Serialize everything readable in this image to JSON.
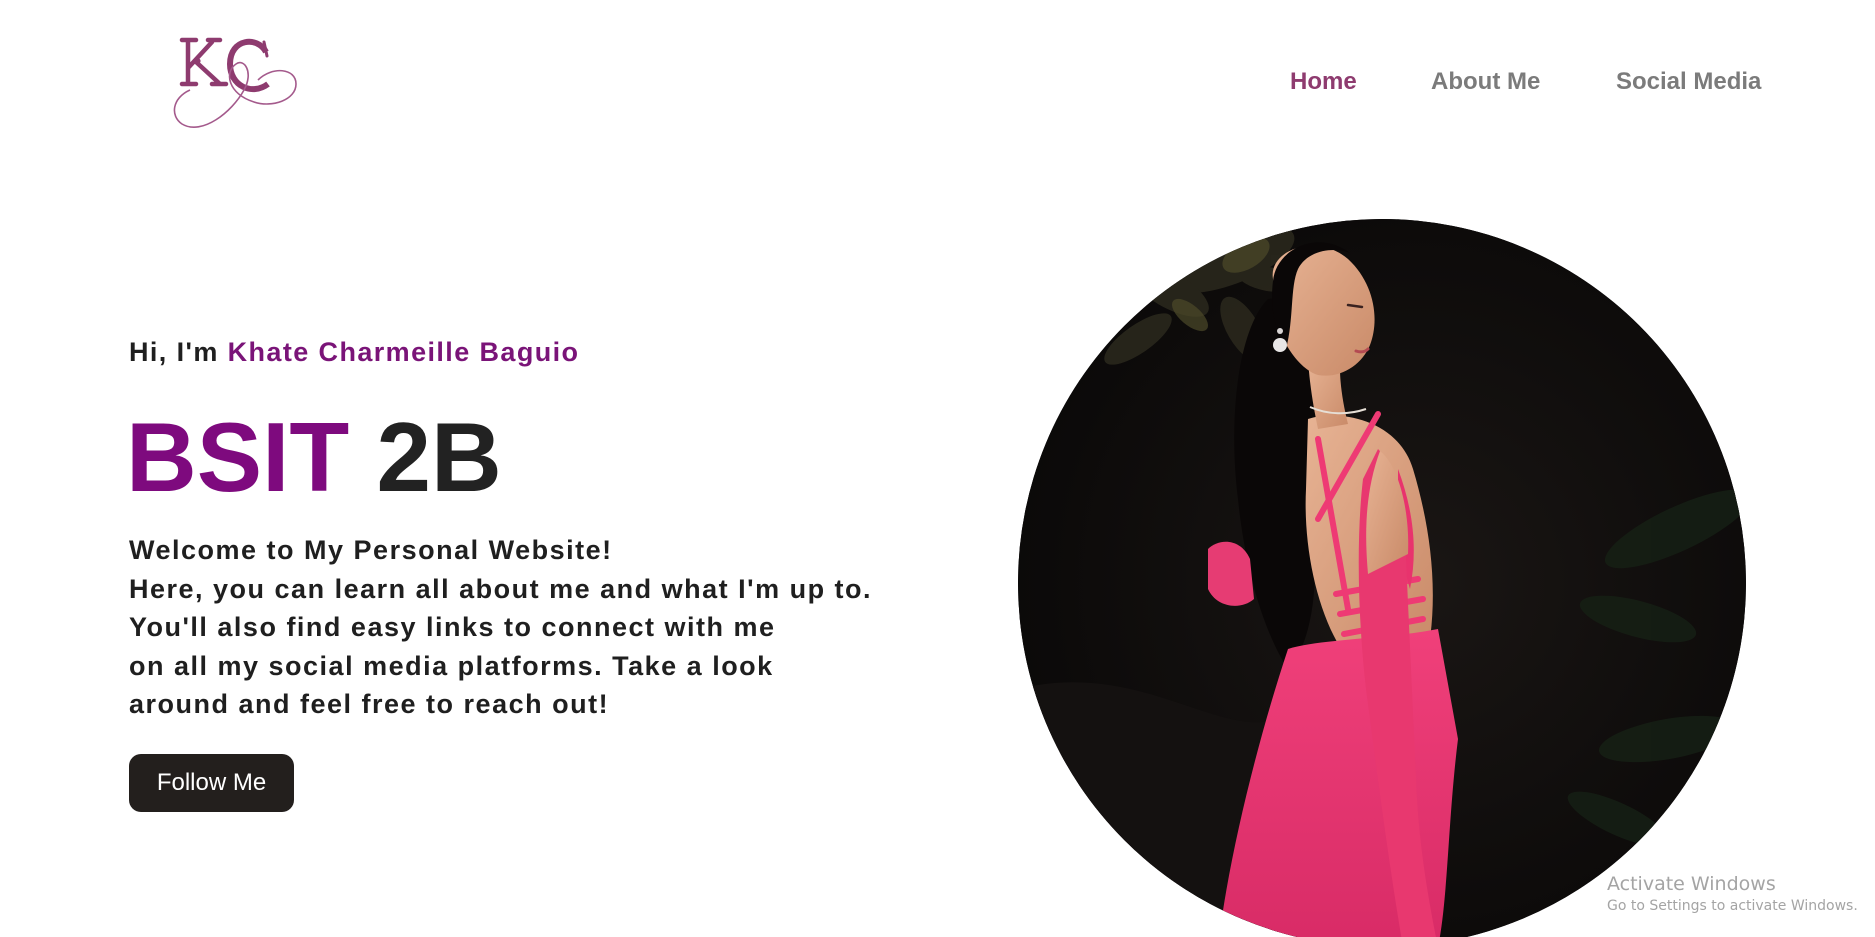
{
  "brand": {
    "logo_text": "KC",
    "accent_color": "#7e0a7e",
    "logo_color": "#8e3b6f"
  },
  "nav": {
    "items": [
      {
        "label": "Home",
        "active": true
      },
      {
        "label": "About Me",
        "active": false
      },
      {
        "label": "Social Media",
        "active": false
      }
    ]
  },
  "hero": {
    "greeting_prefix": "Hi, I'm ",
    "name": "Khate Charmeille Baguio",
    "headline_accent": "BSIT",
    "headline_rest": "2B",
    "intro_lines": [
      "Welcome to My Personal Website!",
      "Here, you can learn all about me and what I'm up to.",
      "You'll also find easy links to connect with me",
      "on all my social media platforms. Take a look",
      "around and feel free to reach out!"
    ],
    "cta_label": "Follow Me",
    "cta_color": "#231f1d"
  },
  "portrait": {
    "icon": "profile-photo"
  },
  "watermark": {
    "title": "Activate Windows",
    "subtitle": "Go to Settings to activate Windows."
  }
}
